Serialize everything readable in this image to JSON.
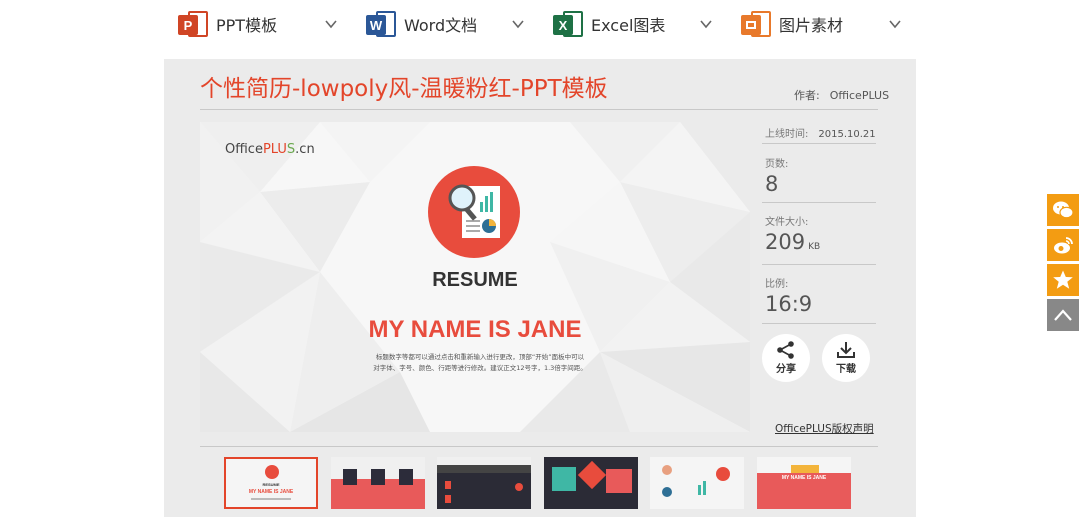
{
  "nav": {
    "items": [
      {
        "label": "PPT模板",
        "icon": "powerpoint-icon",
        "letter": "P",
        "color": "#d04525"
      },
      {
        "label": "Word文档",
        "icon": "word-icon",
        "letter": "W",
        "color": "#2b5797"
      },
      {
        "label": "Excel图表",
        "icon": "excel-icon",
        "letter": "X",
        "color": "#1e7145"
      },
      {
        "label": "图片素材",
        "icon": "image-icon",
        "letter": "",
        "color": "#e8792b"
      }
    ]
  },
  "template": {
    "title": "个性简历-lowpoly风-温暖粉红-PPT模板",
    "author_label": "作者:",
    "author": "OfficePLUS"
  },
  "slide": {
    "logo_text": "Office",
    "logo_plus": "PLU",
    "logo_s": "S",
    "logo_suffix": ".cn",
    "heading": "RESUME",
    "name": "MY NAME IS JANE",
    "body_line1": "标题数字等都可以通过点击和重新输入进行更改，顶部“开始”面板中可以",
    "body_line2": "对字体、字号、颜色、行距等进行修改。建议正文12号字，1.3倍字间距。"
  },
  "meta": {
    "date_label": "上线时间:",
    "date": "2015.10.21",
    "pages_label": "页数:",
    "pages": "8",
    "size_label": "文件大小:",
    "size": "209",
    "size_unit": "KB",
    "ratio_label": "比例:",
    "ratio": "16:9"
  },
  "actions": {
    "share": "分享",
    "download": "下载",
    "copyright": "OfficePLUS版权声明"
  },
  "thumb_labels": {
    "t1_heading": "RESUME",
    "t1_name": "MY NAME IS JANE",
    "t6_name": "MY NAME IS JANE"
  },
  "colors": {
    "accent": "#e3452a",
    "slide_red": "#e84c3d",
    "side_orange": "#f39c12",
    "side_gray": "#888888"
  }
}
